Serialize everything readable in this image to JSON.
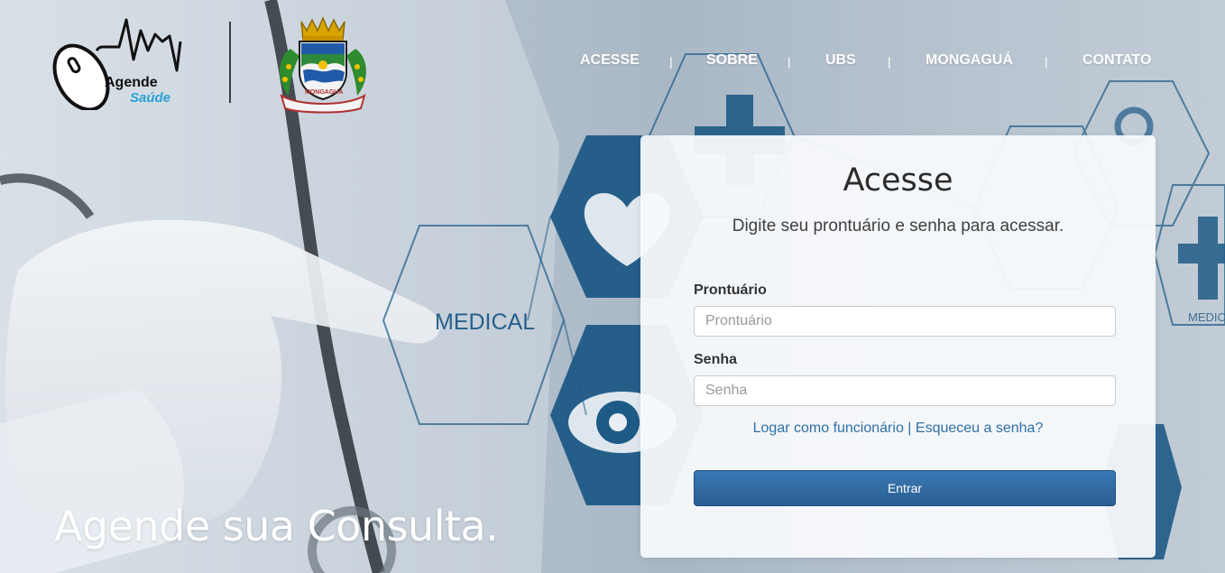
{
  "header": {
    "logo": {
      "line1": "Agende",
      "line2": "Saúde"
    },
    "crest": {
      "banner_text": "MONGAGUÁ"
    },
    "nav": [
      {
        "label": "ACESSE"
      },
      {
        "label": "SOBRE"
      },
      {
        "label": "UBS"
      },
      {
        "label": "MONGAGUÁ"
      },
      {
        "label": "CONTATO"
      }
    ],
    "separator": "|"
  },
  "background": {
    "hex_label_1": "MEDICAL",
    "hex_label_2": "MEDICAL"
  },
  "login": {
    "title": "Acesse",
    "subtitle": "Digite seu prontuário e senha para acessar.",
    "prontuario_label": "Prontuário",
    "prontuario_placeholder": "Prontuário",
    "prontuario_value": "",
    "senha_label": "Senha",
    "senha_placeholder": "Senha",
    "senha_value": "",
    "link_employee": "Logar como funcionário",
    "link_separator": "|",
    "link_forgot": "Esqueceu a senha?",
    "submit_label": "Entrar"
  },
  "hero": {
    "tagline": "Agende sua Consulta."
  },
  "colors": {
    "primary_button": "#2f6a9f",
    "link": "#2f6fa6",
    "hex_blue": "#1e5a86",
    "logo_accent": "#27a3d6"
  }
}
